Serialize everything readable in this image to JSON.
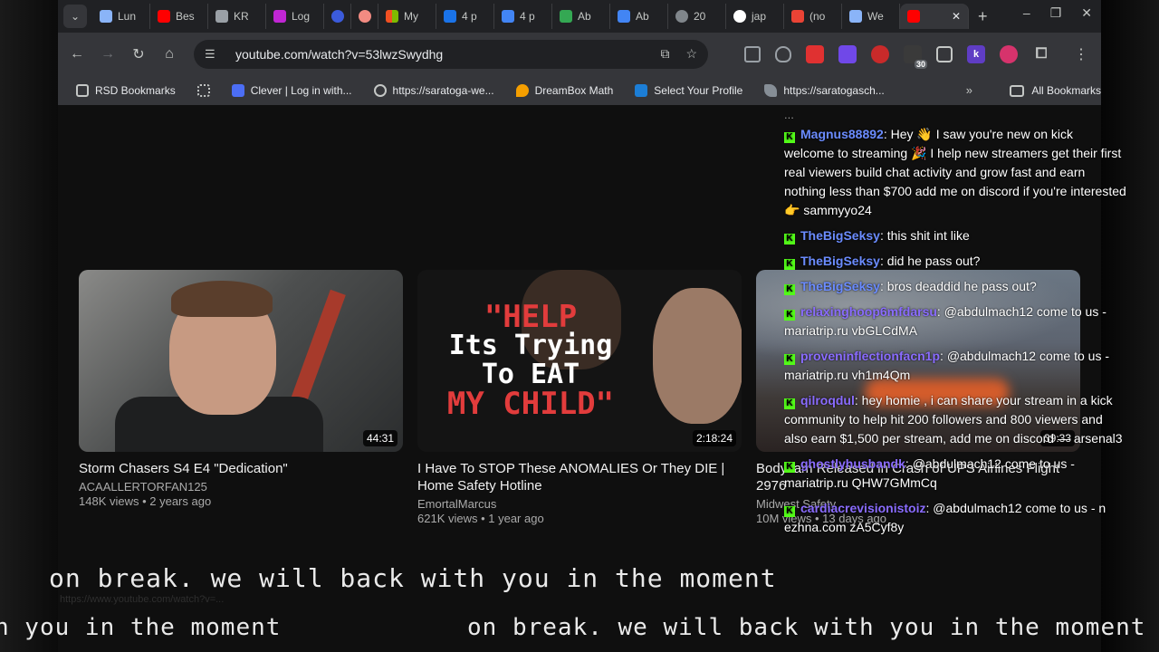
{
  "browser": {
    "tabs": [
      {
        "label": "Lun",
        "fav_color": "#8ab4f8"
      },
      {
        "label": "Bes",
        "fav_color": "#ff0000"
      },
      {
        "label": "KR",
        "fav_color": "#9aa0a6"
      },
      {
        "label": "Log",
        "fav_color": "#c026d3"
      },
      {
        "label": "",
        "fav_color": "#3b5bdb"
      },
      {
        "label": "",
        "fav_color": "#f28b82"
      },
      {
        "label": "My",
        "fav_color": "#f9ab00"
      },
      {
        "label": "4 p",
        "fav_color": "#1a73e8"
      },
      {
        "label": "4 p",
        "fav_color": "#4285f4"
      },
      {
        "label": "Ab",
        "fav_color": "#34a853"
      },
      {
        "label": "Ab",
        "fav_color": "#4285f4"
      },
      {
        "label": "20",
        "fav_color": "#80868b"
      },
      {
        "label": "jap",
        "fav_color": "#ffffff"
      },
      {
        "label": "(no",
        "fav_color": "#ea4335"
      },
      {
        "label": "We",
        "fav_color": "#8ab4f8"
      }
    ],
    "active_tab_close": "✕",
    "new_tab": "+",
    "window_controls": {
      "minimize": "–",
      "restore": "❐",
      "close": "✕"
    },
    "url": "youtube.com/watch?v=53lwzSwydhg",
    "bookmarks": [
      {
        "label": "RSD Bookmarks",
        "color": "#c4c7c5"
      },
      {
        "label": "",
        "color": "#c4c7c5"
      },
      {
        "label": "Clever | Log in with...",
        "color": "#4c6ef5"
      },
      {
        "label": "https://saratoga-we...",
        "color": "#c4c7c5"
      },
      {
        "label": "DreamBox Math",
        "color": "#f59f00"
      },
      {
        "label": "Select Your Profile",
        "color": "#1c7ed6"
      },
      {
        "label": "https://saratogasch...",
        "color": "#c4c7c5"
      }
    ],
    "bookmarks_more": "»",
    "all_bookmarks": "All Bookmarks",
    "ext_badge": "30"
  },
  "videos": [
    {
      "title": "Storm Chasers S4 E4 \"Dedication\"",
      "channel": "ACAALLERTORFAN125",
      "meta": "148K views • 2 years ago",
      "duration": "44:31"
    },
    {
      "title": "I Have To STOP These ANOMALIES Or They DIE | Home Safety Hotline",
      "channel": "EmortalMarcus",
      "meta": "621K views • 1 year ago",
      "duration": "2:18:24",
      "thumb_text_1": "\"HELP",
      "thumb_text_2": "Its Trying",
      "thumb_text_3": "To EAT",
      "thumb_text_4": "MY CHILD\""
    },
    {
      "title": "Bodycam Released in Crash of UPS Airlines Flight 2976",
      "channel": "Midwest Safety",
      "meta": "10M views • 13 days ago",
      "duration": "39:33"
    }
  ],
  "chat": {
    "cut_line": "...",
    "messages": [
      {
        "user": "Magnus88892",
        "color": "#6b8cff",
        "text": "Hey 👋 I saw you're new on kick welcome to streaming 🎉 I help new streamers get their first real viewers build chat activity and grow fast and earn nothing less than $700 add me on discord if you're interested 👉 sammyyo24"
      },
      {
        "user": "TheBigSeksy",
        "color": "#6b8cff",
        "text": "this shit int like"
      },
      {
        "user": "TheBigSeksy",
        "color": "#6b8cff",
        "text": "did he pass out?"
      },
      {
        "user": "TheBigSeksy",
        "color": "#6b8cff",
        "text": "bros deaddid he pass out?"
      },
      {
        "user": "relaxinghoop6mfdarsu",
        "color": "#8a6cff",
        "text": "@abdulmach12 come to us - mariatrip.ru vbGLCdMA"
      },
      {
        "user": "proveninflectionfacn1p",
        "color": "#8a6cff",
        "text": "@abdulmach12 come to us - mariatrip.ru vh1m4Qm"
      },
      {
        "user": "qilroqdul",
        "color": "#8a6cff",
        "text": "hey homie , i can share your stream in a kick community to help hit 200 followers and 800 viewers and also earn $1,500 per stream, add me on discord — arsenal3"
      },
      {
        "user": "ghostlyhusbandk",
        "color": "#8a6cff",
        "text": "@abdulmach12 come to us - mariatrip.ru QHW7GMmCq"
      },
      {
        "user": "cardiacrevisionistoiz",
        "color": "#8a6cff",
        "text": "@abdulmach12 come to us - n ezhna.com zA5Cyf8y"
      }
    ]
  },
  "overlay": {
    "ticker_top": "on break. we will back with you in the moment",
    "ticker_bottom_a": "h you in the moment",
    "ticker_bottom_b": "on break. we will back with you in the moment",
    "status_url": "https://www.youtube.com/watch?v=..."
  }
}
